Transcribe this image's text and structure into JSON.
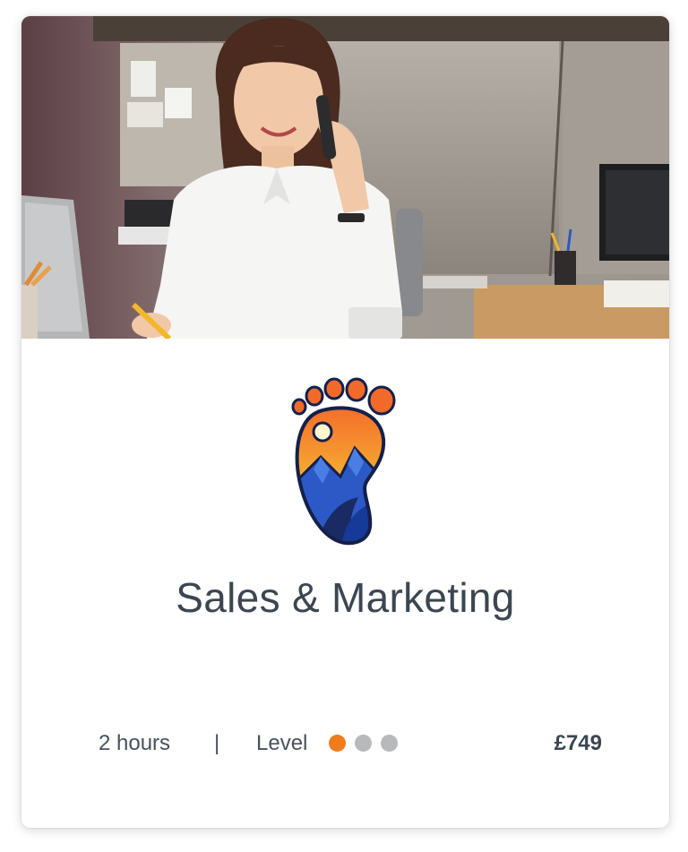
{
  "course": {
    "title": "Sales & Marketing",
    "duration": "2 hours",
    "divider": "|",
    "level_label": "Level",
    "level": {
      "value": 1,
      "max": 3
    },
    "price": "£749"
  },
  "hero": {
    "image": "woman-on-phone-at-desk-photo"
  },
  "logo": {
    "icon": "footprint-mountain-logo"
  },
  "colors": {
    "accent": "#f07d1d",
    "inactive_dot": "#b8b9bb",
    "text": "#3c4651"
  }
}
